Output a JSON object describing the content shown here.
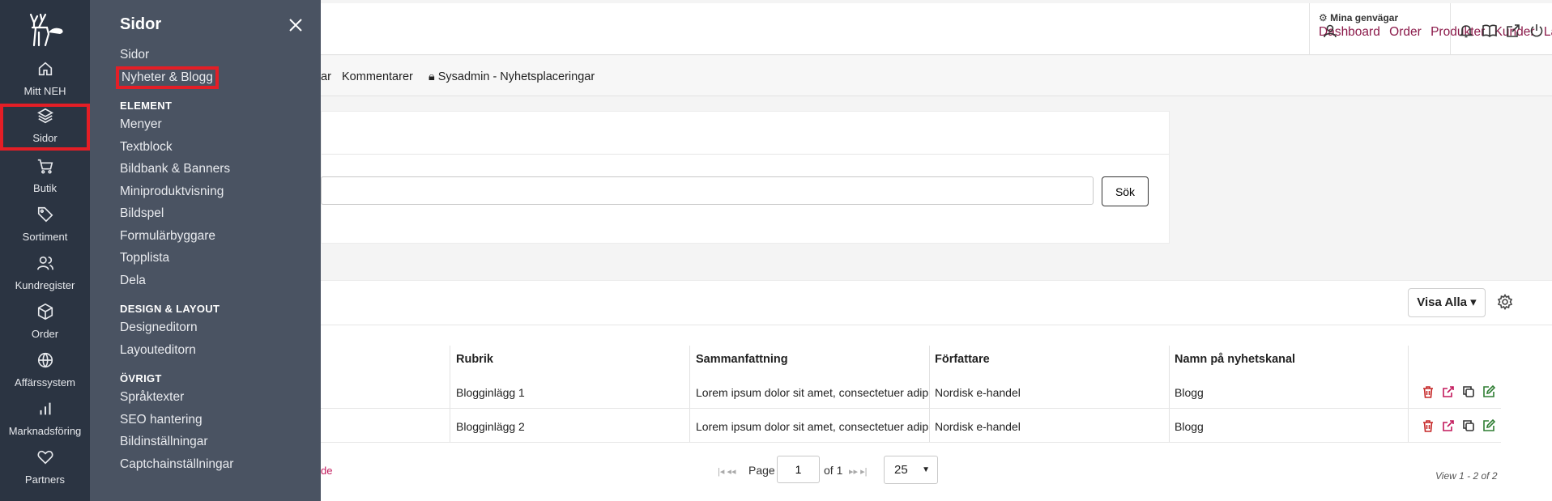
{
  "rail": {
    "items": [
      {
        "label": "Mitt NEH",
        "icon": "home-icon"
      },
      {
        "label": "Sidor",
        "icon": "layers-icon"
      },
      {
        "label": "Butik",
        "icon": "cart-icon"
      },
      {
        "label": "Sortiment",
        "icon": "tag-icon"
      },
      {
        "label": "Kundregister",
        "icon": "users-icon"
      },
      {
        "label": "Order",
        "icon": "box-icon"
      },
      {
        "label": "Affärssystem",
        "icon": "globe-icon"
      },
      {
        "label": "Marknadsföring",
        "icon": "bar-chart-icon"
      },
      {
        "label": "Partners",
        "icon": "heart-icon"
      }
    ],
    "active": "Sidor",
    "highlight_color": "#e41e26"
  },
  "flyout": {
    "title": "Sidor",
    "links_top": [
      "Sidor",
      "Nyheter & Blogg"
    ],
    "section_element": "ELEMENT",
    "links_element": [
      "Menyer",
      "Textblock",
      "Bildbank & Banners",
      "Miniproduktvisning",
      "Bildspel",
      "Formulärbyggare",
      "Topplista",
      "Dela"
    ],
    "section_design": "DESIGN & LAYOUT",
    "links_design": [
      "Designeditorn",
      "Layouteditorn"
    ],
    "section_ovrigt": "ÖVRIGT",
    "links_ovrigt": [
      "Språktexter",
      "SEO hantering",
      "Bildinställningar",
      "Captchainställningar"
    ]
  },
  "header": {
    "shortcuts_label": "Mina genvägar",
    "shortcuts": [
      "Dashboard",
      "Order",
      "Produkter",
      "Kunder",
      "Layouteditorn"
    ],
    "link_color": "#8b1a4a"
  },
  "subnav": {
    "partial": "ar",
    "items": [
      "Kommentarer",
      "Sysadmin - Nyhetsplaceringar"
    ]
  },
  "search": {
    "placeholder": "",
    "button_label": "Sök"
  },
  "table": {
    "visa_label": "Visa Alla",
    "columns": [
      "Rubrik",
      "Sammanfattning",
      "Författare",
      "Namn på nyhetskanal"
    ],
    "rows": [
      {
        "rubrik": "Blogginlägg 1",
        "sammanfattning": "Lorem ipsum dolor sit amet, consectetuer adip",
        "forfattare": "Nordisk e-handel",
        "kanal": "Blogg"
      },
      {
        "rubrik": "Blogginlägg 2",
        "sammanfattning": "Lorem ipsum dolor sit amet, consectetuer adip",
        "forfattare": "Nordisk e-handel",
        "kanal": "Blogg"
      }
    ],
    "leftover_text": "de"
  },
  "pager": {
    "page_label": "Page",
    "page_value": "1",
    "of_label": "of 1",
    "page_size": "25",
    "view_info": "View 1 - 2 of 2"
  }
}
